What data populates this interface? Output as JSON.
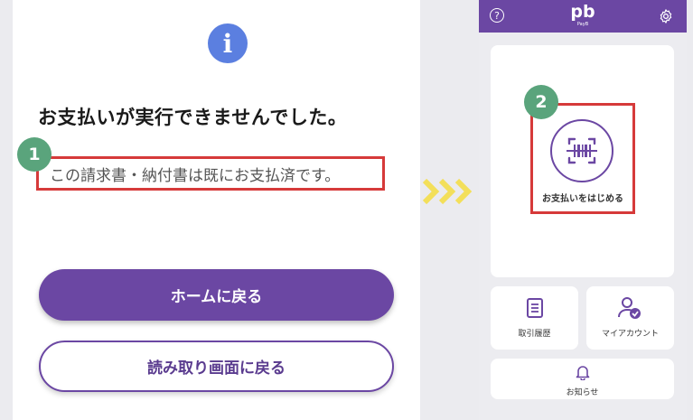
{
  "left": {
    "info_icon": "i",
    "title": "お支払いが実行できませんでした。",
    "badge": "1",
    "message": "この請求書・納付書は既にお支払済です。",
    "home_button": "ホームに戻る",
    "back_scan_button": "読み取り画面に戻る"
  },
  "right": {
    "header": {
      "help_icon": "?",
      "logo": "pb",
      "logo_sub": "PayB"
    },
    "badge": "2",
    "scan_label": "お支払いをはじめる",
    "history_label": "取引履歴",
    "account_label": "マイアカウント",
    "notice_label": "お知らせ"
  },
  "colors": {
    "brand_purple": "#6b47a3",
    "badge_green": "#5aa47c",
    "highlight_red": "#d63a3a",
    "info_blue": "#5b7fe0",
    "arrow_yellow": "#f3df5a"
  }
}
